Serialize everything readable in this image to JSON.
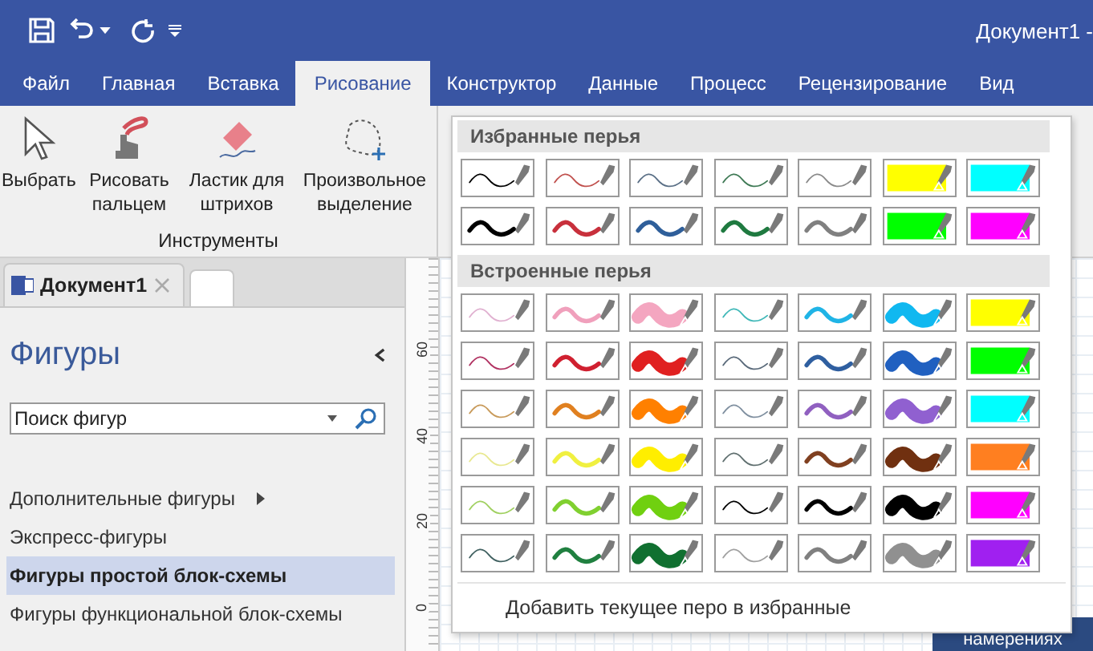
{
  "window": {
    "title": "Документ1 -"
  },
  "ribbon_tabs": [
    {
      "label": "Файл",
      "selected": false
    },
    {
      "label": "Главная",
      "selected": false
    },
    {
      "label": "Вставка",
      "selected": false
    },
    {
      "label": "Рисование",
      "selected": true
    },
    {
      "label": "Конструктор",
      "selected": false
    },
    {
      "label": "Данные",
      "selected": false
    },
    {
      "label": "Процесс",
      "selected": false
    },
    {
      "label": "Рецензирование",
      "selected": false
    },
    {
      "label": "Вид",
      "selected": false
    }
  ],
  "tools": {
    "group_label": "Инструменты",
    "buttons": [
      {
        "kind": "select",
        "label": "Выбрать"
      },
      {
        "kind": "finger",
        "label": "Рисовать пальцем"
      },
      {
        "kind": "eraser",
        "label": "Ластик для штрихов"
      },
      {
        "kind": "lasso",
        "label": "Произвольное выделение"
      }
    ]
  },
  "document_tab": {
    "label": "Документ1"
  },
  "shapes_pane": {
    "title": "Фигуры",
    "search": {
      "placeholder": "Поиск фигур"
    },
    "items": [
      {
        "label": "Дополнительные фигуры",
        "submenu": true,
        "selected": false
      },
      {
        "label": "Экспресс-фигуры",
        "submenu": false,
        "selected": false
      },
      {
        "label": "Фигуры простой блок-схемы",
        "submenu": false,
        "selected": true
      },
      {
        "label": "Фигуры функциональной блок-схемы",
        "submenu": false,
        "selected": false
      }
    ]
  },
  "ruler": {
    "labels": [
      "60",
      "40",
      "20",
      "0"
    ]
  },
  "pen_gallery": {
    "sections": [
      {
        "title": "Избранные перья",
        "pens": [
          {
            "kind": "thin",
            "color": "#000000"
          },
          {
            "kind": "thin",
            "color": "#c0504d"
          },
          {
            "kind": "thin",
            "color": "#5a6f86"
          },
          {
            "kind": "thin",
            "color": "#3f7a55"
          },
          {
            "kind": "thin",
            "color": "#8a8a8a"
          },
          {
            "kind": "highlighter",
            "color": "#ffff00"
          },
          {
            "kind": "highlighter",
            "color": "#00ffff"
          },
          {
            "kind": "medium",
            "color": "#000000"
          },
          {
            "kind": "medium",
            "color": "#c8303c"
          },
          {
            "kind": "medium",
            "color": "#2f5f9a"
          },
          {
            "kind": "medium",
            "color": "#1f7a40"
          },
          {
            "kind": "medium",
            "color": "#808080"
          },
          {
            "kind": "highlighter",
            "color": "#00ff00"
          },
          {
            "kind": "highlighter",
            "color": "#ff00ff"
          }
        ]
      },
      {
        "title": "Встроенные перья",
        "pens": [
          {
            "kind": "thin",
            "color": "#e0b0d0"
          },
          {
            "kind": "medium",
            "color": "#f0a0bc"
          },
          {
            "kind": "thick",
            "color": "#f4a6c0"
          },
          {
            "kind": "thin",
            "color": "#40b8b8"
          },
          {
            "kind": "medium",
            "color": "#20b4e6"
          },
          {
            "kind": "thick",
            "color": "#10b8f0"
          },
          {
            "kind": "highlighter",
            "color": "#ffff00"
          },
          {
            "kind": "thin",
            "color": "#b03060"
          },
          {
            "kind": "medium",
            "color": "#d02030"
          },
          {
            "kind": "thick",
            "color": "#e02020"
          },
          {
            "kind": "thin",
            "color": "#5a6a7a"
          },
          {
            "kind": "medium",
            "color": "#2f5fa0"
          },
          {
            "kind": "thick",
            "color": "#2060c0"
          },
          {
            "kind": "highlighter",
            "color": "#00ff00"
          },
          {
            "kind": "thin",
            "color": "#c89a5a"
          },
          {
            "kind": "medium",
            "color": "#e08020"
          },
          {
            "kind": "thick",
            "color": "#ff8000"
          },
          {
            "kind": "thin",
            "color": "#8090a0"
          },
          {
            "kind": "medium",
            "color": "#9060c0"
          },
          {
            "kind": "thick",
            "color": "#9060d0"
          },
          {
            "kind": "highlighter",
            "color": "#00ffff"
          },
          {
            "kind": "thin",
            "color": "#e8e890"
          },
          {
            "kind": "medium",
            "color": "#f0f040"
          },
          {
            "kind": "thick",
            "color": "#ffee00"
          },
          {
            "kind": "thin",
            "color": "#607070"
          },
          {
            "kind": "medium",
            "color": "#804020"
          },
          {
            "kind": "thick",
            "color": "#703010"
          },
          {
            "kind": "highlighter",
            "color": "#ff7f20"
          },
          {
            "kind": "thin",
            "color": "#a0d060"
          },
          {
            "kind": "medium",
            "color": "#80d030"
          },
          {
            "kind": "thick",
            "color": "#70d010"
          },
          {
            "kind": "thin",
            "color": "#000000"
          },
          {
            "kind": "medium",
            "color": "#000000"
          },
          {
            "kind": "thick",
            "color": "#000000"
          },
          {
            "kind": "highlighter",
            "color": "#ff00ff"
          },
          {
            "kind": "thin",
            "color": "#406060"
          },
          {
            "kind": "medium",
            "color": "#208040"
          },
          {
            "kind": "thick",
            "color": "#107030"
          },
          {
            "kind": "thin",
            "color": "#a0a0a0"
          },
          {
            "kind": "medium",
            "color": "#808080"
          },
          {
            "kind": "thick",
            "color": "#909090"
          },
          {
            "kind": "highlighter",
            "color": "#a020f0"
          }
        ]
      }
    ],
    "footer": "Добавить текущее перо в избранные"
  },
  "canvas": {
    "shape_text": "намерениях"
  }
}
